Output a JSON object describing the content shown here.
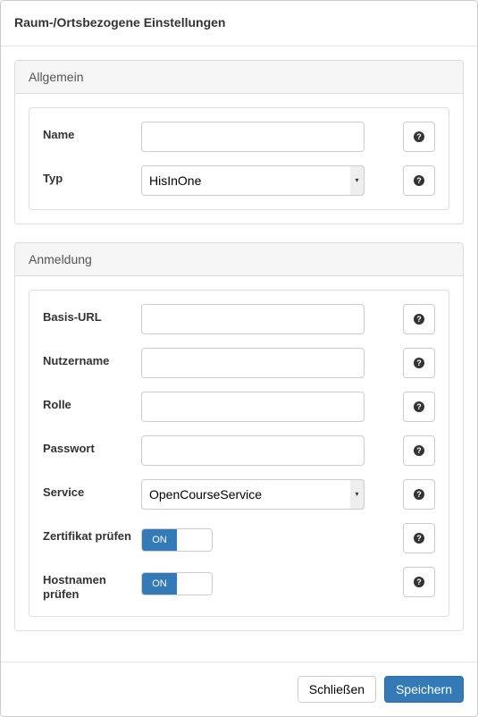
{
  "title": "Raum-/Ortsbezogene Einstellungen",
  "sections": {
    "general": {
      "heading": "Allgemein",
      "name": {
        "label": "Name",
        "value": ""
      },
      "type": {
        "label": "Typ",
        "selected": "HisInOne"
      }
    },
    "auth": {
      "heading": "Anmeldung",
      "baseurl": {
        "label": "Basis-URL",
        "value": ""
      },
      "username": {
        "label": "Nutzername",
        "value": ""
      },
      "role": {
        "label": "Rolle",
        "value": ""
      },
      "password": {
        "label": "Passwort",
        "value": ""
      },
      "service": {
        "label": "Service",
        "selected": "OpenCourseService"
      },
      "verifycert": {
        "label": "Zertifikat prüfen",
        "state": "ON"
      },
      "verifyhost": {
        "label": "Hostnamen prüfen",
        "state": "ON"
      }
    }
  },
  "footer": {
    "close": "Schließen",
    "save": "Speichern"
  },
  "help_glyph": "?"
}
